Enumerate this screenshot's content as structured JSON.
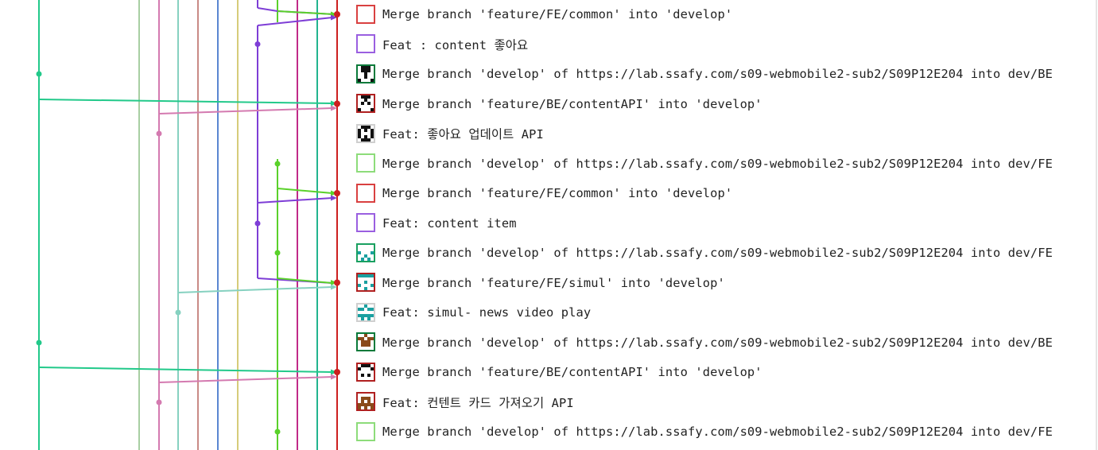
{
  "graph": {
    "lane_colors": [
      "#22c98a",
      "#a8cfa2",
      "#d47ab0",
      "#86d1c0",
      "#c98a86",
      "#5a86d1",
      "#d6cc7a",
      "#7e3ed6",
      "#5ad12a",
      "#c02a88",
      "#22b48e",
      "#cc1f1f"
    ],
    "main_color": "#cc1f1f"
  },
  "commits": [
    {
      "message": "Merge branch 'feature/FE/common' into 'develop'",
      "avatar_icon": "identicon-red-outline",
      "avatar_color": "#d94040"
    },
    {
      "message": "Feat : content 좋아요",
      "avatar_icon": "identicon-purple-outline",
      "avatar_color": "#9a5fe0"
    },
    {
      "message": "Merge branch 'develop' of https://lab.ssafy.com/s09-webmobile2-sub2/S09P12E204 into dev/BE",
      "avatar_icon": "identicon-black-green",
      "avatar_color": "#0a7a3a"
    },
    {
      "message": "Merge branch 'feature/BE/contentAPI' into 'develop'",
      "avatar_icon": "identicon-black-red",
      "avatar_color": "#b02020"
    },
    {
      "message": "Feat: 좋아요 업데이트 API",
      "avatar_icon": "identicon-black-white",
      "avatar_color": "#cfcfcf"
    },
    {
      "message": "Merge branch 'develop' of https://lab.ssafy.com/s09-webmobile2-sub2/S09P12E204 into dev/FE",
      "avatar_icon": "identicon-lightgreen-outline",
      "avatar_color": "#8ddc7a"
    },
    {
      "message": "Merge branch 'feature/FE/common' into 'develop'",
      "avatar_icon": "identicon-red-outline",
      "avatar_color": "#d94040"
    },
    {
      "message": "Feat: content item",
      "avatar_icon": "identicon-purple-outline",
      "avatar_color": "#9a5fe0"
    },
    {
      "message": "Merge branch 'develop' of https://lab.ssafy.com/s09-webmobile2-sub2/S09P12E204 into dev/FE",
      "avatar_icon": "identicon-teal-green",
      "avatar_color": "#1aa060"
    },
    {
      "message": "Merge branch 'feature/FE/simul' into 'develop'",
      "avatar_icon": "identicon-teal-red",
      "avatar_color": "#b02020"
    },
    {
      "message": "Feat: simul- news video play",
      "avatar_icon": "identicon-teal-white",
      "avatar_color": "#cfcfcf"
    },
    {
      "message": "Merge branch 'develop' of https://lab.ssafy.com/s09-webmobile2-sub2/S09P12E204 into dev/BE",
      "avatar_icon": "identicon-brown-green",
      "avatar_color": "#0a7a3a"
    },
    {
      "message": "Merge branch 'feature/BE/contentAPI' into 'develop'",
      "avatar_icon": "identicon-black-red",
      "avatar_color": "#b02020"
    },
    {
      "message": "Feat: 컨텐트 카드 가져오기 API",
      "avatar_icon": "identicon-brown-red",
      "avatar_color": "#b02020"
    },
    {
      "message": "Merge branch 'develop' of https://lab.ssafy.com/s09-webmobile2-sub2/S09P12E204 into dev/FE",
      "avatar_icon": "identicon-lightgreen-outline",
      "avatar_color": "#8ddc7a"
    }
  ]
}
